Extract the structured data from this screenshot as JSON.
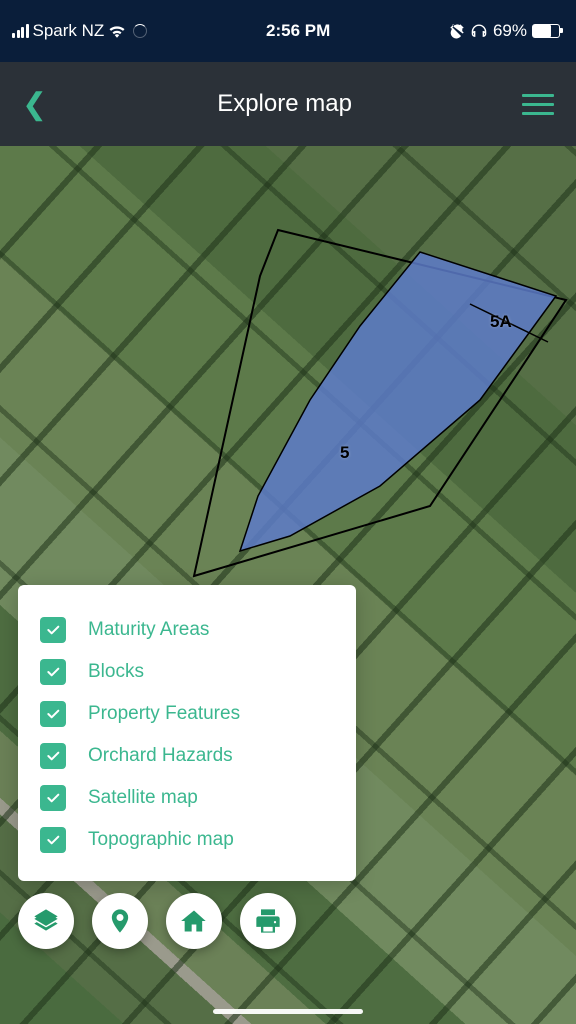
{
  "status": {
    "carrier": "Spark NZ",
    "time": "2:56 PM",
    "battery_pct": "69%"
  },
  "header": {
    "title": "Explore map"
  },
  "map": {
    "blocks": [
      {
        "label": "5"
      },
      {
        "label": "5A"
      }
    ]
  },
  "layers": {
    "items": [
      {
        "label": "Maturity Areas",
        "checked": true
      },
      {
        "label": "Blocks",
        "checked": true
      },
      {
        "label": "Property Features",
        "checked": true
      },
      {
        "label": "Orchard Hazards",
        "checked": true
      },
      {
        "label": "Satellite map",
        "checked": true
      },
      {
        "label": "Topographic map",
        "checked": true
      }
    ]
  },
  "colors": {
    "accent": "#3bb78f",
    "block_fill": "#5d7bc9",
    "header_bg": "#2b3138",
    "status_bg": "#0a1e3a"
  }
}
